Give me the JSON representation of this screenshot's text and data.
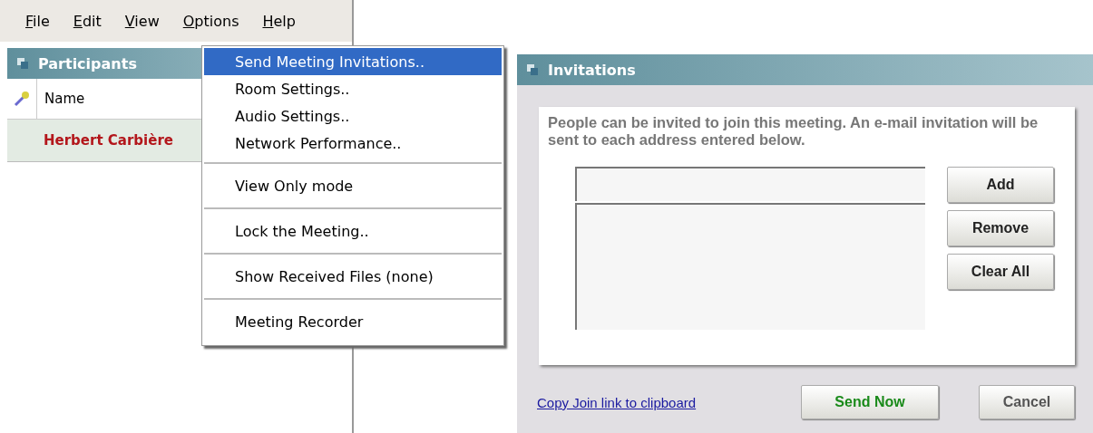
{
  "menubar": [
    "File",
    "Edit",
    "View",
    "Options",
    "Help"
  ],
  "options_menu": {
    "groups": [
      [
        {
          "label": "Send Meeting Invitations..",
          "selected": true
        },
        {
          "label": "Room Settings..",
          "selected": false
        },
        {
          "label": "Audio Settings..",
          "selected": false
        },
        {
          "label": "Network Performance..",
          "selected": false
        }
      ],
      [
        {
          "label": "View Only mode",
          "selected": false
        }
      ],
      [
        {
          "label": "Lock the Meeting..",
          "selected": false
        }
      ],
      [
        {
          "label": "Show Received Files  (none)",
          "selected": false
        }
      ],
      [
        {
          "label": "Meeting Recorder",
          "selected": false
        }
      ]
    ]
  },
  "participants": {
    "title": "Participants",
    "column": "Name",
    "rows": [
      {
        "name": "Herbert Carbière",
        "selected": true
      }
    ]
  },
  "invitations": {
    "title": "Invitations",
    "text": "People can be invited to join this meeting.  An e-mail invitation will be sent to each address entered below.",
    "buttons": [
      "Add",
      "Remove",
      "Clear All"
    ],
    "link": "Copy Join link to clipboard",
    "send": "Send Now",
    "cancel": "Cancel"
  }
}
